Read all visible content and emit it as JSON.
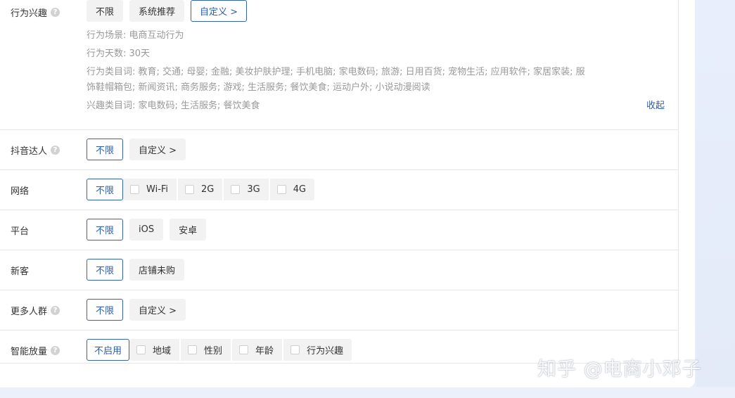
{
  "behavior_interest": {
    "label": "行为兴趣",
    "options": [
      "不限",
      "系统推荐",
      "自定义 >"
    ],
    "details": {
      "scene": "行为场景:  电商互动行为",
      "days": "行为天数:  30天",
      "category_line1": "行为类目词:  教育; 交通; 母婴; 金融; 美妆护肤护理; 手机电脑; 家电数码; 旅游; 日用百货; 宠物生活; 应用软件; 家居家装; 服",
      "category_line2": "饰鞋帽箱包; 新闻资讯; 商务服务; 游戏; 生活服务; 餐饮美食; 运动户外; 小说动漫阅读",
      "interest": "兴趣类目词:  家电数码; 生活服务; 餐饮美食"
    },
    "collapse": "收起"
  },
  "douyin": {
    "label": "抖音达人",
    "options": [
      "不限",
      "自定义 >"
    ]
  },
  "network": {
    "label": "网络",
    "options": [
      "不限"
    ],
    "checks": [
      "Wi-Fi",
      "2G",
      "3G",
      "4G"
    ]
  },
  "platform": {
    "label": "平台",
    "options": [
      "不限",
      "iOS",
      "安卓"
    ]
  },
  "new_customer": {
    "label": "新客",
    "options": [
      "不限",
      "店铺未购"
    ]
  },
  "more_crowd": {
    "label": "更多人群",
    "options": [
      "不限",
      "自定义 >"
    ]
  },
  "smart_expand": {
    "label": "智能放量",
    "options": [
      "不启用"
    ],
    "checks": [
      "地域",
      "性别",
      "年龄",
      "行为兴趣"
    ]
  },
  "help_icon": "?",
  "watermark": "知乎 @电商小邓子",
  "colors": {
    "accent": "#2a5db0",
    "chip_bg": "#f2f2f2"
  }
}
